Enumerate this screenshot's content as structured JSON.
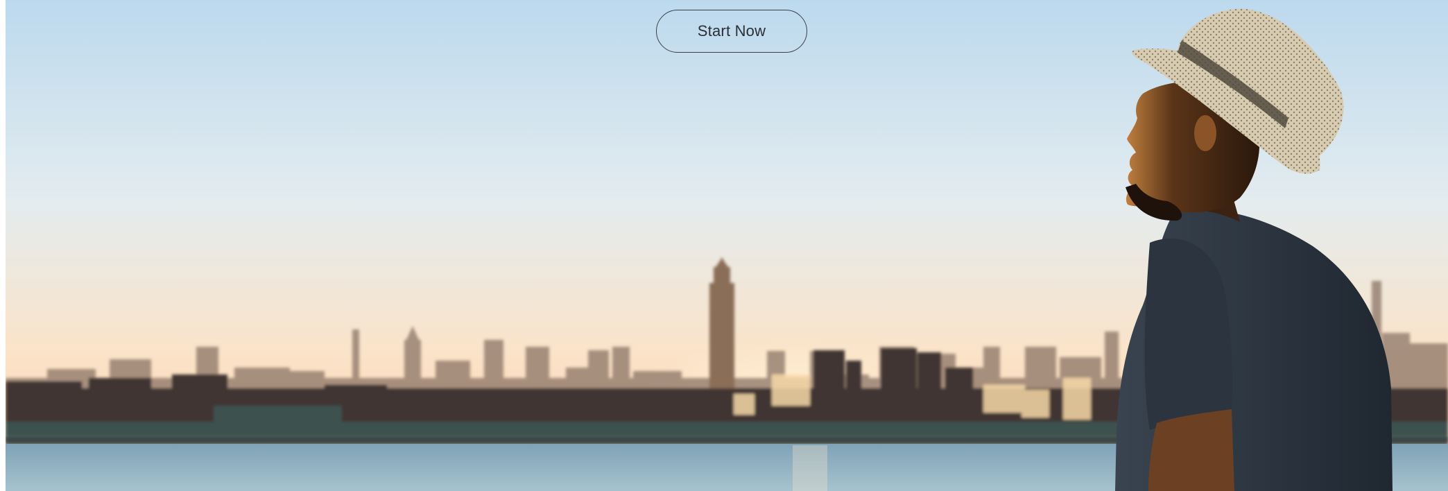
{
  "hero": {
    "cta_label": "Start Now"
  },
  "colors": {
    "sky_top": "#bcd9ee",
    "sky_horizon": "#fbe3c8",
    "water": "#8fb1c3",
    "button_border": "#3b3f47",
    "button_text": "#2b2f36"
  }
}
